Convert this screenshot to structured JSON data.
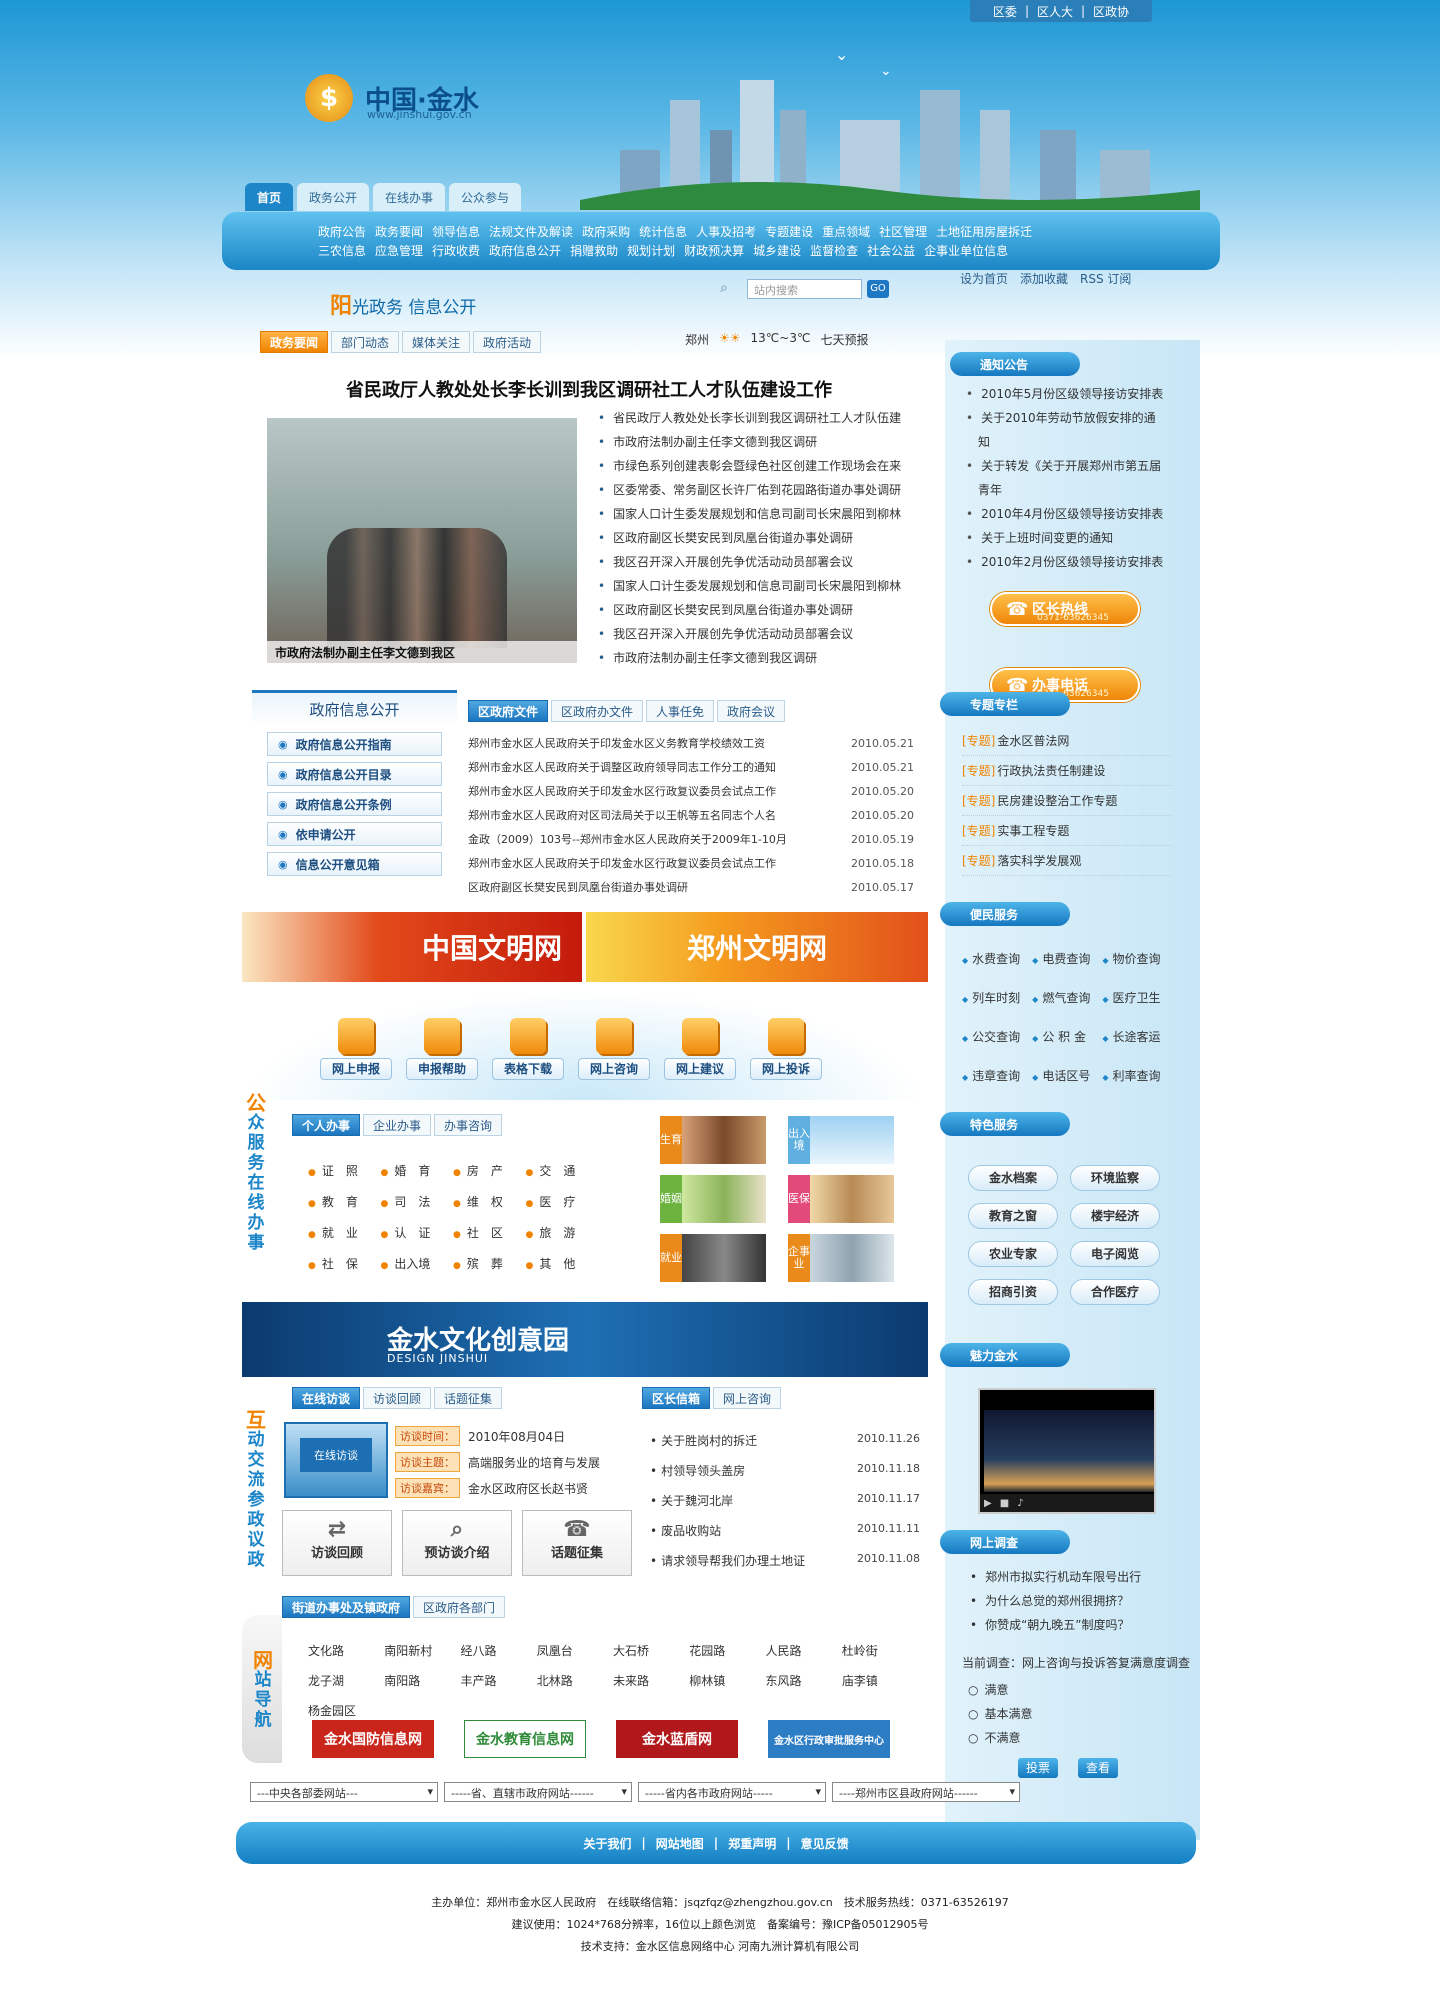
{
  "top_links": [
    "区委",
    "区人大",
    "区政协"
  ],
  "logo": {
    "text": "中国·金水",
    "url": "www.jinshui.gov.cn"
  },
  "nav_tabs": [
    "首页",
    "政务公开",
    "在线办事",
    "公众参与"
  ],
  "nav_links_row1": [
    "政府公告",
    "政务要闻",
    "领导信息",
    "法规文件及解读",
    "政府采购",
    "统计信息",
    "人事及招考",
    "专题建设",
    "重点领域",
    "社区管理",
    "土地征用房屋拆迁"
  ],
  "nav_links_row2": [
    "三农信息",
    "应急管理",
    "行政收费",
    "政府信息公开",
    "捐赠救助",
    "规划计划",
    "财政预决算",
    "城乡建设",
    "监督检查",
    "社会公益",
    "企事业单位信息"
  ],
  "sub_links": [
    "设为首页",
    "添加收藏",
    "RSS 订阅"
  ],
  "search": {
    "placeholder": "站内搜索",
    "button": "GO"
  },
  "sunshine": {
    "first": "阳",
    "rest": "光政务  信息公开"
  },
  "news_tabs": [
    "政务要闻",
    "部门动态",
    "媒体关注",
    "政府活动"
  ],
  "weather": {
    "city": "郑州",
    "temp": "13℃~3℃",
    "link": "七天预报"
  },
  "headline": "省民政厅人教处处长李长训到我区调研社工人才队伍建设工作",
  "photo_caption": "市政府法制办副主任李文德到我区",
  "news_list": [
    "省民政厅人教处处长李长训到我区调研社工人才队伍建",
    "市政府法制办副主任李文德到我区调研",
    "市绿色系列创建表彰会暨绿色社区创建工作现场会在来",
    "区委常委、常务副区长许厂佑到花园路街道办事处调研",
    "国家人口计生委发展规划和信息司副司长宋晨阳到柳林",
    "区政府副区长樊安民到凤凰台街道办事处调研",
    "我区召开深入开展创先争优活动动员部署会议",
    "国家人口计生委发展规划和信息司副司长宋晨阳到柳林",
    "区政府副区长樊安民到凤凰台街道办事处调研",
    "我区召开深入开展创先争优活动动员部署会议",
    "市政府法制办副主任李文德到我区调研"
  ],
  "gov_info": {
    "title": "政府信息公开",
    "buttons": [
      "政府信息公开指南",
      "政府信息公开目录",
      "政府信息公开条例",
      "依申请公开",
      "信息公开意见箱"
    ]
  },
  "doc_tabs": [
    "区政府文件",
    "区政府办文件",
    "人事任免",
    "政府会议"
  ],
  "docs": [
    {
      "t": "郑州市金水区人民政府关于印发金水区义务教育学校绩效工资",
      "d": "2010.05.21"
    },
    {
      "t": "郑州市金水区人民政府关于调整区政府领导同志工作分工的通知",
      "d": "2010.05.21"
    },
    {
      "t": "郑州市金水区人民政府关于印发金水区行政复议委员会试点工作",
      "d": "2010.05.20"
    },
    {
      "t": "郑州市金水区人民政府对区司法局关于以王帆等五名同志个人名",
      "d": "2010.05.20"
    },
    {
      "t": "金政（2009）103号--郑州市金水区人民政府关于2009年1-10月",
      "d": "2010.05.19"
    },
    {
      "t": "郑州市金水区人民政府关于印发金水区行政复议委员会试点工作",
      "d": "2010.05.18"
    },
    {
      "t": "区政府副区长樊安民到凤凰台街道办事处调研",
      "d": "2010.05.17"
    }
  ],
  "banners": {
    "left": "中国文明网",
    "right": "郑州文明网"
  },
  "services": [
    "网上申报",
    "申报帮助",
    "表格下载",
    "网上咨询",
    "网上建议",
    "网上投诉"
  ],
  "side_titles": {
    "public": [
      "公",
      "众",
      "服",
      "务",
      "在",
      "线",
      "办",
      "事"
    ],
    "interact": [
      "互",
      "动",
      "交",
      "流",
      "参",
      "政",
      "议",
      "政"
    ],
    "nav": [
      "网",
      "站",
      "导",
      "航"
    ]
  },
  "person_tabs": [
    "个人办事",
    "企业办事",
    "办事咨询"
  ],
  "person_items": [
    "证　照",
    "婚　育",
    "房　产",
    "交　通",
    "教　育",
    "司　法",
    "维　权",
    "医　疗",
    "就　业",
    "认　证",
    "社　区",
    "旅　游",
    "社　保",
    "出入境",
    "殡　葬",
    "其　他"
  ],
  "photo_labels": [
    "生育",
    "出入境",
    "婚姻",
    "医保",
    "就业",
    "企事业"
  ],
  "culture": {
    "title": "金水文化创意园",
    "sub": "DESIGN JINSHUI"
  },
  "interview_tabs": [
    "在线访谈",
    "访谈回顾",
    "话题征集"
  ],
  "interview_img_text": "在线访谈",
  "interview": {
    "time_k": "访谈时间：",
    "time_v": "2010年08月04日",
    "topic_k": "访谈主题：",
    "topic_v": "高端服务业的培育与发展",
    "guest_k": "访谈嘉宾：",
    "guest_v": "金水区政府区长赵书贤"
  },
  "big_buttons": [
    "访谈回顾",
    "预访谈介绍",
    "话题征集"
  ],
  "mail_tabs": [
    "区长信箱",
    "网上咨询"
  ],
  "mails": [
    {
      "t": "关于胜岗村的拆迁",
      "d": "2010.11.26"
    },
    {
      "t": "村领导领头盖房",
      "d": "2010.11.18"
    },
    {
      "t": "关于魏河北岸",
      "d": "2010.11.17"
    },
    {
      "t": "废品收购站",
      "d": "2010.11.11"
    },
    {
      "t": "请求领导帮我们办理土地证",
      "d": "2010.11.08"
    }
  ],
  "street_tabs": [
    "街道办事处及镇政府",
    "区政府各部门"
  ],
  "streets": [
    "文化路",
    "南阳新村",
    "经八路",
    "凤凰台",
    "大石桥",
    "花园路",
    "人民路",
    "杜岭街",
    "龙子湖",
    "南阳路",
    "丰产路",
    "北林路",
    "未来路",
    "柳林镇",
    "东风路",
    "庙李镇",
    "杨金园区"
  ],
  "logo_links": [
    "金水国防信息网",
    "金水教育信息网",
    "金水蓝盾网",
    "金水区行政审批服务中心"
  ],
  "selects": [
    "---中央各部委网站---",
    "-----省、直辖市政府网站------",
    "-----省内各市政府网站-----",
    "----郑州市区县政府网站------"
  ],
  "footer_links": [
    "关于我们",
    "网站地图",
    "郑重声明",
    "意见反馈"
  ],
  "footer_info": [
    "主办单位：郑州市金水区人民政府　在线联络信箱：jsqzfqz@zhengzhou.gov.cn　技术服务热线：0371-63526197",
    "建议使用：1024*768分辨率，16位以上颜色浏览　备案编号：豫ICP备05012905号",
    "技术支持：金水区信息网络中心 河南九洲计算机有限公司"
  ],
  "notice": {
    "title": "通知公告",
    "items": [
      "2010年5月份区级领导接访安排表",
      "关于2010年劳动节放假安排的通知",
      "关于转发《关于开展郑州市第五届青年",
      "2010年4月份区级领导接访安排表",
      "关于上班时间变更的通知",
      "2010年2月份区级领导接访安排表"
    ]
  },
  "hotlines": [
    {
      "label": "区长热线",
      "num": "0371-63626345"
    },
    {
      "label": "办事电话",
      "num": "0371-63626345"
    }
  ],
  "special": {
    "title": "专题专栏",
    "tag": "[专题]",
    "items": [
      "金水区普法网",
      "行政执法责任制建设",
      "民房建设整治工作专题",
      "实事工程专题",
      "落实科学发展观"
    ]
  },
  "convenience": {
    "title": "便民服务",
    "items": [
      "水费查询",
      "电费查询",
      "物价查询",
      "列车时刻",
      "燃气查询",
      "医疗卫生",
      "公交查询",
      "公 积 金",
      "长途客运",
      "违章查询",
      "电话区号",
      "利率查询"
    ]
  },
  "featured": {
    "title": "特色服务",
    "items": [
      "金水档案",
      "环境监察",
      "教育之窗",
      "楼宇经济",
      "农业专家",
      "电子阅览",
      "招商引资",
      "合作医疗"
    ]
  },
  "charm": {
    "title": "魅力金水"
  },
  "survey": {
    "title": "网上调查",
    "items": [
      "郑州市拟实行机动车限号出行",
      "为什么总觉的郑州很拥挤？",
      "你赞成“朝九晚五”制度吗？"
    ],
    "current": "当前调查：网上咨询与投诉答复满意度调查",
    "options": [
      "满意",
      "基本满意",
      "不满意"
    ],
    "buttons": [
      "投票",
      "查看"
    ]
  }
}
